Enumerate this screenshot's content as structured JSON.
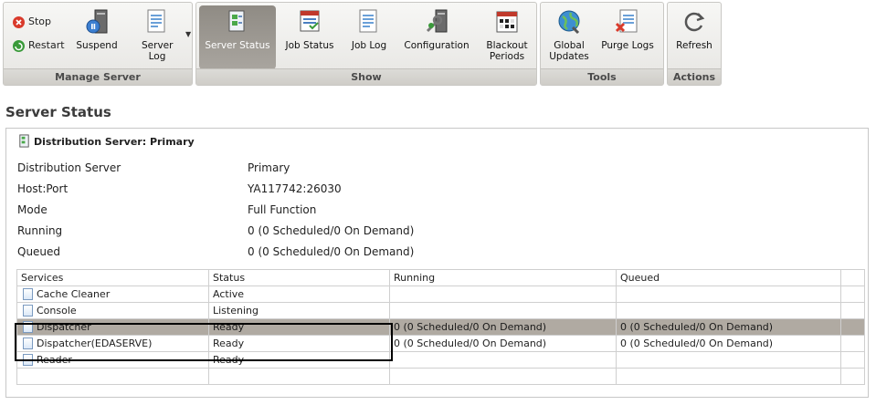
{
  "ribbon": {
    "manage": {
      "stop": "Stop",
      "restart": "Restart",
      "suspend": "Suspend",
      "server_log": "Server Log",
      "label": "Manage Server"
    },
    "show": {
      "server_status": "Server Status",
      "job_status": "Job Status",
      "job_log": "Job Log",
      "configuration": "Configuration",
      "blackout_periods": "Blackout Periods",
      "label": "Show"
    },
    "tools": {
      "global_updates": "Global Updates",
      "purge_logs": "Purge Logs",
      "label": "Tools"
    },
    "actions": {
      "refresh": "Refresh",
      "label": "Actions"
    }
  },
  "page_title": "Server Status",
  "panel": {
    "header": "Distribution Server: Primary",
    "properties": [
      {
        "label": "Distribution Server",
        "value": "Primary"
      },
      {
        "label": "Host:Port",
        "value": "YA117742:26030"
      },
      {
        "label": "Mode",
        "value": "Full Function"
      },
      {
        "label": "Running",
        "value": "0 (0 Scheduled/0 On Demand)"
      },
      {
        "label": "Queued",
        "value": "0 (0 Scheduled/0 On Demand)"
      }
    ]
  },
  "services_table": {
    "columns": [
      "Services",
      "Status",
      "Running",
      "Queued"
    ],
    "rows": [
      {
        "service": "Cache Cleaner",
        "status": "Active",
        "running": "",
        "queued": ""
      },
      {
        "service": "Console",
        "status": "Listening",
        "running": "",
        "queued": ""
      },
      {
        "service": "Dispatcher",
        "status": "Ready",
        "running": "0 (0 Scheduled/0 On Demand)",
        "queued": "0 (0 Scheduled/0 On Demand)"
      },
      {
        "service": "Dispatcher(EDASERVE)",
        "status": "Ready",
        "running": "0 (0 Scheduled/0 On Demand)",
        "queued": "0 (0 Scheduled/0 On Demand)"
      },
      {
        "service": "Reader",
        "status": "Ready",
        "running": "",
        "queued": ""
      }
    ],
    "selected_row": 2
  },
  "colors": {
    "selected_row": "#b0aaa2",
    "active_button": "#9a968f",
    "stop": "#d93a2b",
    "restart": "#3a9a3a"
  }
}
